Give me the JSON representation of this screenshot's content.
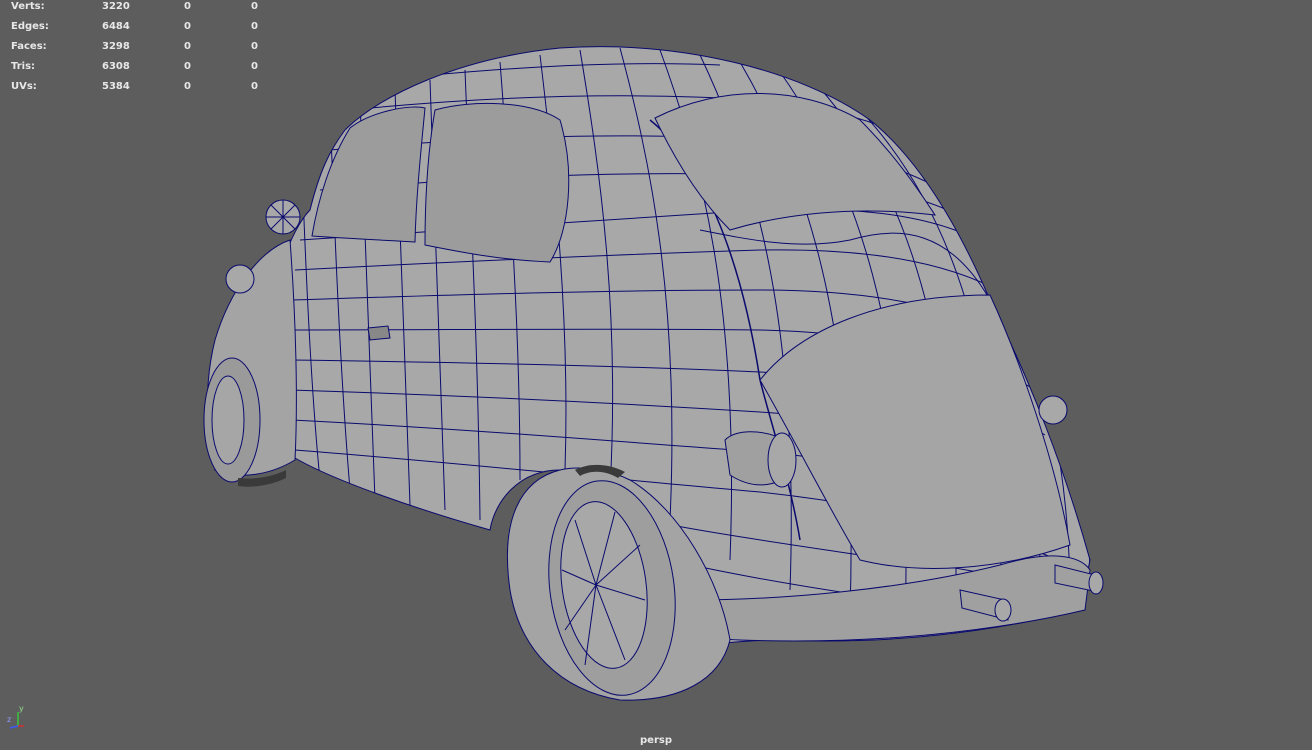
{
  "hud": {
    "rows": [
      {
        "label": "Verts:",
        "total": "3220",
        "selected": "0",
        "component": "0"
      },
      {
        "label": "Edges:",
        "total": "6484",
        "selected": "0",
        "component": "0"
      },
      {
        "label": "Faces:",
        "total": "3298",
        "selected": "0",
        "component": "0"
      },
      {
        "label": "Tris:",
        "total": "6308",
        "selected": "0",
        "component": "0"
      },
      {
        "label": "UVs:",
        "total": "5384",
        "selected": "0",
        "component": "0"
      }
    ]
  },
  "camera": {
    "label": "persp"
  },
  "axis": {
    "y": "y",
    "z": "z"
  },
  "colors": {
    "background": "#5d5d5d",
    "mesh_fill": "#a8a8a8",
    "wire": "#0a0a6e",
    "hud_text": "#e8e8e8"
  }
}
